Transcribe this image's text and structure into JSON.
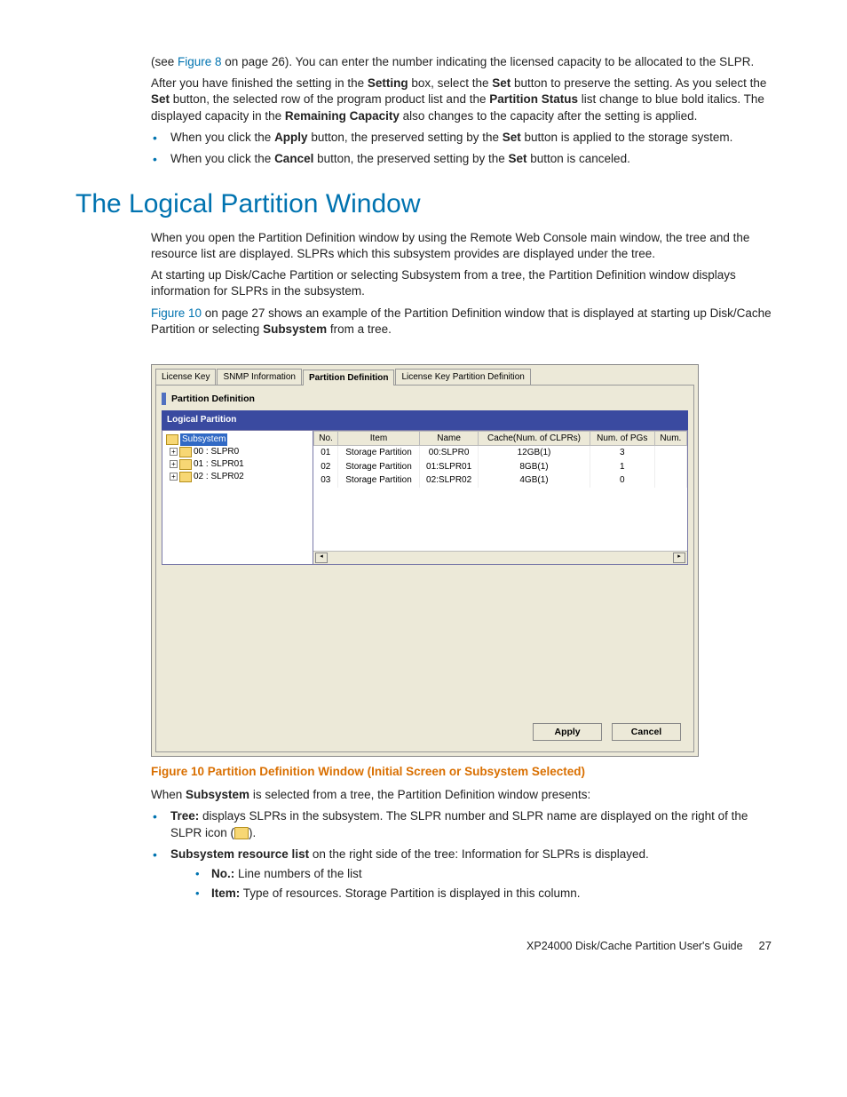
{
  "intro": {
    "text1a": "(see ",
    "fig8": "Figure 8",
    "text1b": " on page 26).  You can enter the number indicating the licensed capacity to be allocated to the SLPR.",
    "text2a": "After you have finished the setting in the ",
    "bold_setting": "Setting",
    "text2b": " box, select the ",
    "bold_set": "Set",
    "text2c": " button to preserve the setting. As you select the ",
    "text2d": " button, the selected row of the program product list and the ",
    "bold_ps": "Partition Status",
    "text2e": " list change to blue bold italics. The displayed capacity in the ",
    "bold_rc": "Remaining Capacity",
    "text2f": " also changes to the capacity after the setting is applied."
  },
  "bullets_top": [
    {
      "pre": "When you click the ",
      "b1": "Apply",
      "mid": " button, the preserved setting by the ",
      "b2": "Set",
      "post": " button is applied to the storage system."
    },
    {
      "pre": "When you click the ",
      "b1": "Cancel",
      "mid": " button, the preserved setting by the ",
      "b2": "Set",
      "post": " button is canceled."
    }
  ],
  "heading": "The Logical Partition Window",
  "para1": "When you open the Partition Definition window by using the Remote Web Console main window, the tree and the resource list are displayed. SLPRs which this subsystem provides are displayed under the tree.",
  "para2": "At starting up Disk/Cache Partition or selecting Subsystem from a tree, the Partition Definition window displays information for SLPRs in the subsystem.",
  "para3": {
    "link": "Figure 10",
    "a": " on page 27 shows an example of the Partition Definition window that is displayed at starting up Disk/Cache Partition or selecting ",
    "b": "Subsystem",
    "c": " from a tree."
  },
  "ui": {
    "tabs": [
      "License Key",
      "SNMP Information",
      "Partition Definition",
      "License Key Partition Definition"
    ],
    "panel_title": "Partition Definition",
    "lp_header": "Logical Partition",
    "tree": {
      "root": "Subsystem",
      "nodes": [
        "00 : SLPR0",
        "01 : SLPR01",
        "02 : SLPR02"
      ]
    },
    "columns": [
      "No.",
      "Item",
      "Name",
      "Cache(Num. of CLPRs)",
      "Num. of PGs",
      "Num."
    ],
    "rows": [
      {
        "no": "01",
        "item": "Storage Partition",
        "name": "00:SLPR0",
        "cache": "12GB(1)",
        "pgs": "3",
        "num": ""
      },
      {
        "no": "02",
        "item": "Storage Partition",
        "name": "01:SLPR01",
        "cache": "8GB(1)",
        "pgs": "1",
        "num": ""
      },
      {
        "no": "03",
        "item": "Storage Partition",
        "name": "02:SLPR02",
        "cache": "4GB(1)",
        "pgs": "0",
        "num": ""
      }
    ],
    "apply": "Apply",
    "cancel": "Cancel"
  },
  "caption": "Figure 10 Partition Definition Window (Initial Screen or Subsystem Selected)",
  "para4": {
    "a": "When ",
    "b": "Subsystem",
    "c": " is selected from a tree, the Partition Definition window presents:"
  },
  "bullets_bottom": {
    "tree": {
      "b": "Tree:",
      "t": " displays SLPRs in the subsystem. The SLPR number and SLPR name are displayed on the right of the SLPR icon (",
      "t2": ")."
    },
    "srl": {
      "b": "Subsystem resource list",
      "t": " on the right side of the tree: Information for SLPRs is displayed."
    },
    "sub": [
      {
        "b": "No.:",
        "t": " Line numbers of the list"
      },
      {
        "b": "Item:",
        "t": " Type of resources. Storage Partition is displayed in this column."
      }
    ]
  },
  "footer": {
    "title": "XP24000 Disk/Cache Partition User's Guide",
    "page": "27"
  }
}
